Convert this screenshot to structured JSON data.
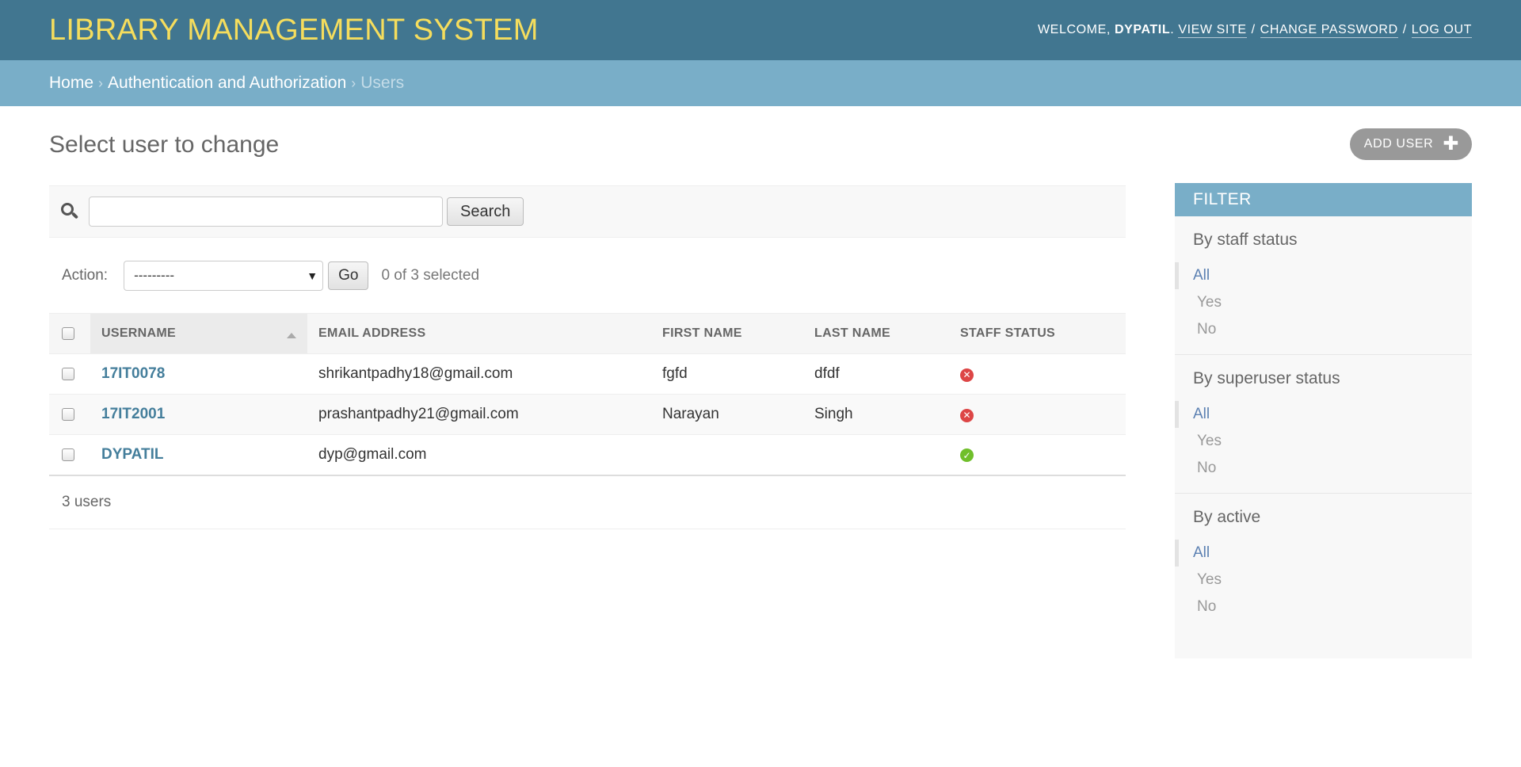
{
  "header": {
    "site_title": "LIBRARY MANAGEMENT SYSTEM",
    "welcome_prefix": "WELCOME,",
    "username": "DYPATIL",
    "username_suffix": ".",
    "view_site": "VIEW SITE",
    "change_password": "CHANGE PASSWORD",
    "log_out": "LOG OUT",
    "separator": "/"
  },
  "breadcrumbs": {
    "home": "Home",
    "section": "Authentication and Authorization",
    "current": "Users",
    "arrow": "›"
  },
  "page": {
    "title": "Select user to change",
    "add_button": "ADD USER"
  },
  "search": {
    "value": "",
    "placeholder": "",
    "button": "Search"
  },
  "actions": {
    "label": "Action:",
    "selected_option": "---------",
    "go": "Go",
    "selected_count": "0 of 3 selected"
  },
  "table": {
    "columns": [
      "USERNAME",
      "EMAIL ADDRESS",
      "FIRST NAME",
      "LAST NAME",
      "STAFF STATUS"
    ],
    "sorted_column": "USERNAME",
    "rows": [
      {
        "username": "17IT0078",
        "email": "shrikantpadhy18@gmail.com",
        "first_name": "fgfd",
        "last_name": "dfdf",
        "staff_status": "no"
      },
      {
        "username": "17IT2001",
        "email": "prashantpadhy21@gmail.com",
        "first_name": "Narayan",
        "last_name": "Singh",
        "staff_status": "no"
      },
      {
        "username": "DYPATIL",
        "email": "dyp@gmail.com",
        "first_name": "",
        "last_name": "",
        "staff_status": "yes"
      }
    ]
  },
  "paginator": {
    "text": "3 users"
  },
  "filter": {
    "title": "FILTER",
    "groups": [
      {
        "heading": "By staff status",
        "options": [
          "All",
          "Yes",
          "No"
        ],
        "selected": "All"
      },
      {
        "heading": "By superuser status",
        "options": [
          "All",
          "Yes",
          "No"
        ],
        "selected": "All"
      },
      {
        "heading": "By active",
        "options": [
          "All",
          "Yes",
          "No"
        ],
        "selected": "All"
      }
    ]
  },
  "colors": {
    "header_bg": "#417690",
    "breadcrumb_bg": "#79aec8",
    "site_title": "#f5dd5d",
    "link": "#447e9b",
    "status_no": "#dd4646",
    "status_yes": "#70bf2b"
  },
  "icons": {
    "search": "search-icon",
    "add": "plus-icon",
    "sort": "sort-ascending-icon",
    "status_no": "x-circle-icon",
    "status_yes": "check-circle-icon"
  }
}
